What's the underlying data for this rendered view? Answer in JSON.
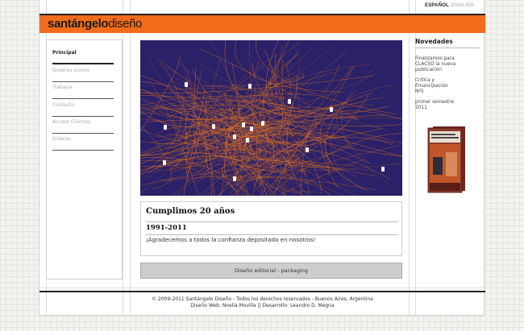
{
  "brand": {
    "logo_bold": "santángelo",
    "logo_light": "diseño"
  },
  "languages": {
    "es": "ESPAÑOL",
    "en": "ENGLISH"
  },
  "nav": [
    {
      "label": "Principal",
      "active": true
    },
    {
      "label": "Quiénes somos",
      "active": false
    },
    {
      "label": "Trabajos",
      "active": false
    },
    {
      "label": "Contacto",
      "active": false
    },
    {
      "label": "Acceso Clientes",
      "active": false
    },
    {
      "label": "Enlaces",
      "active": false
    }
  ],
  "hero": {
    "colors": {
      "background": "#2a2168",
      "strands": "#e8741a"
    }
  },
  "news": {
    "title": "Cumplimos 20 años",
    "subtitle": "1991-2011",
    "text": "¡Agradecemos a todos la confianza depositada en nosotros!"
  },
  "category_button": "Diseño editorial - packaging",
  "sidebar_right": {
    "title": "Novedades",
    "line1": "Finalizamos para",
    "line2": "CLACSO la nueva",
    "line3": "publicación",
    "book_title_1": "Crítica y",
    "book_title_2": "Emancipación",
    "issue": "Nº5",
    "period_1": "primer semestre",
    "period_2": "2011"
  },
  "footer": {
    "line1": "© 2009-2011 Santángelo Diseño - Todos los derechos reservados - Buenos Aires, Argentina",
    "line2": "Diseño Web: Noelia Movilla || Desarrollo: Leandro D. Megna"
  },
  "colors": {
    "accent": "#f26c1c",
    "dark": "#222222"
  }
}
